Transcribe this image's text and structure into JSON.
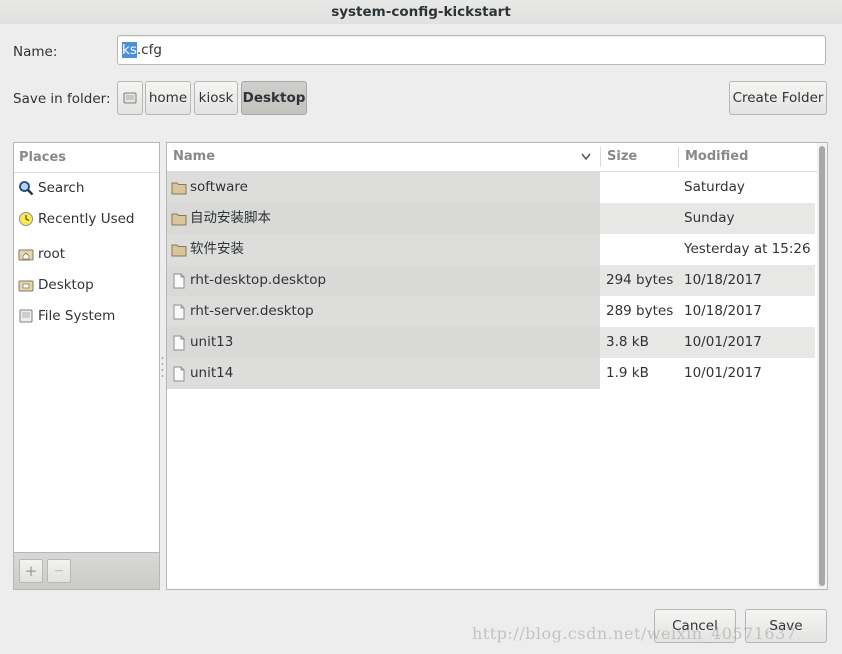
{
  "window": {
    "title": "system-config-kickstart"
  },
  "name_row": {
    "label": "Name:",
    "value_selected": "ks",
    "value_rest": ".cfg"
  },
  "folder_row": {
    "label": "Save in folder:",
    "path": [
      "home",
      "kiosk",
      "Desktop"
    ],
    "active": "Desktop",
    "create_folder_label": "Create Folder"
  },
  "places": {
    "header": "Places",
    "items": [
      {
        "label": "Search",
        "icon": "search-icon"
      },
      {
        "label": "Recently Used",
        "icon": "recent-icon"
      },
      {
        "label": "root",
        "icon": "home-folder-icon"
      },
      {
        "label": "Desktop",
        "icon": "desktop-folder-icon"
      },
      {
        "label": "File System",
        "icon": "drive-icon"
      }
    ],
    "add_label": "+",
    "remove_label": "—"
  },
  "files": {
    "columns": {
      "name": "Name",
      "size": "Size",
      "modified": "Modified"
    },
    "rows": [
      {
        "name": "software",
        "size": "",
        "modified": "Saturday",
        "type": "folder"
      },
      {
        "name": "自动安装脚本",
        "size": "",
        "modified": "Sunday",
        "type": "folder"
      },
      {
        "name": "软件安装",
        "size": "",
        "modified": "Yesterday at 15:26",
        "type": "folder"
      },
      {
        "name": "rht-desktop.desktop",
        "size": "294 bytes",
        "modified": "10/18/2017",
        "type": "file"
      },
      {
        "name": "rht-server.desktop",
        "size": "289 bytes",
        "modified": "10/18/2017",
        "type": "file"
      },
      {
        "name": "unit13",
        "size": "3.8 kB",
        "modified": "10/01/2017",
        "type": "file"
      },
      {
        "name": "unit14",
        "size": "1.9 kB",
        "modified": "10/01/2017",
        "type": "file"
      }
    ]
  },
  "buttons": {
    "cancel": "Cancel",
    "save": "Save"
  },
  "watermark": "http://blog.csdn.net/weixin_40571637"
}
